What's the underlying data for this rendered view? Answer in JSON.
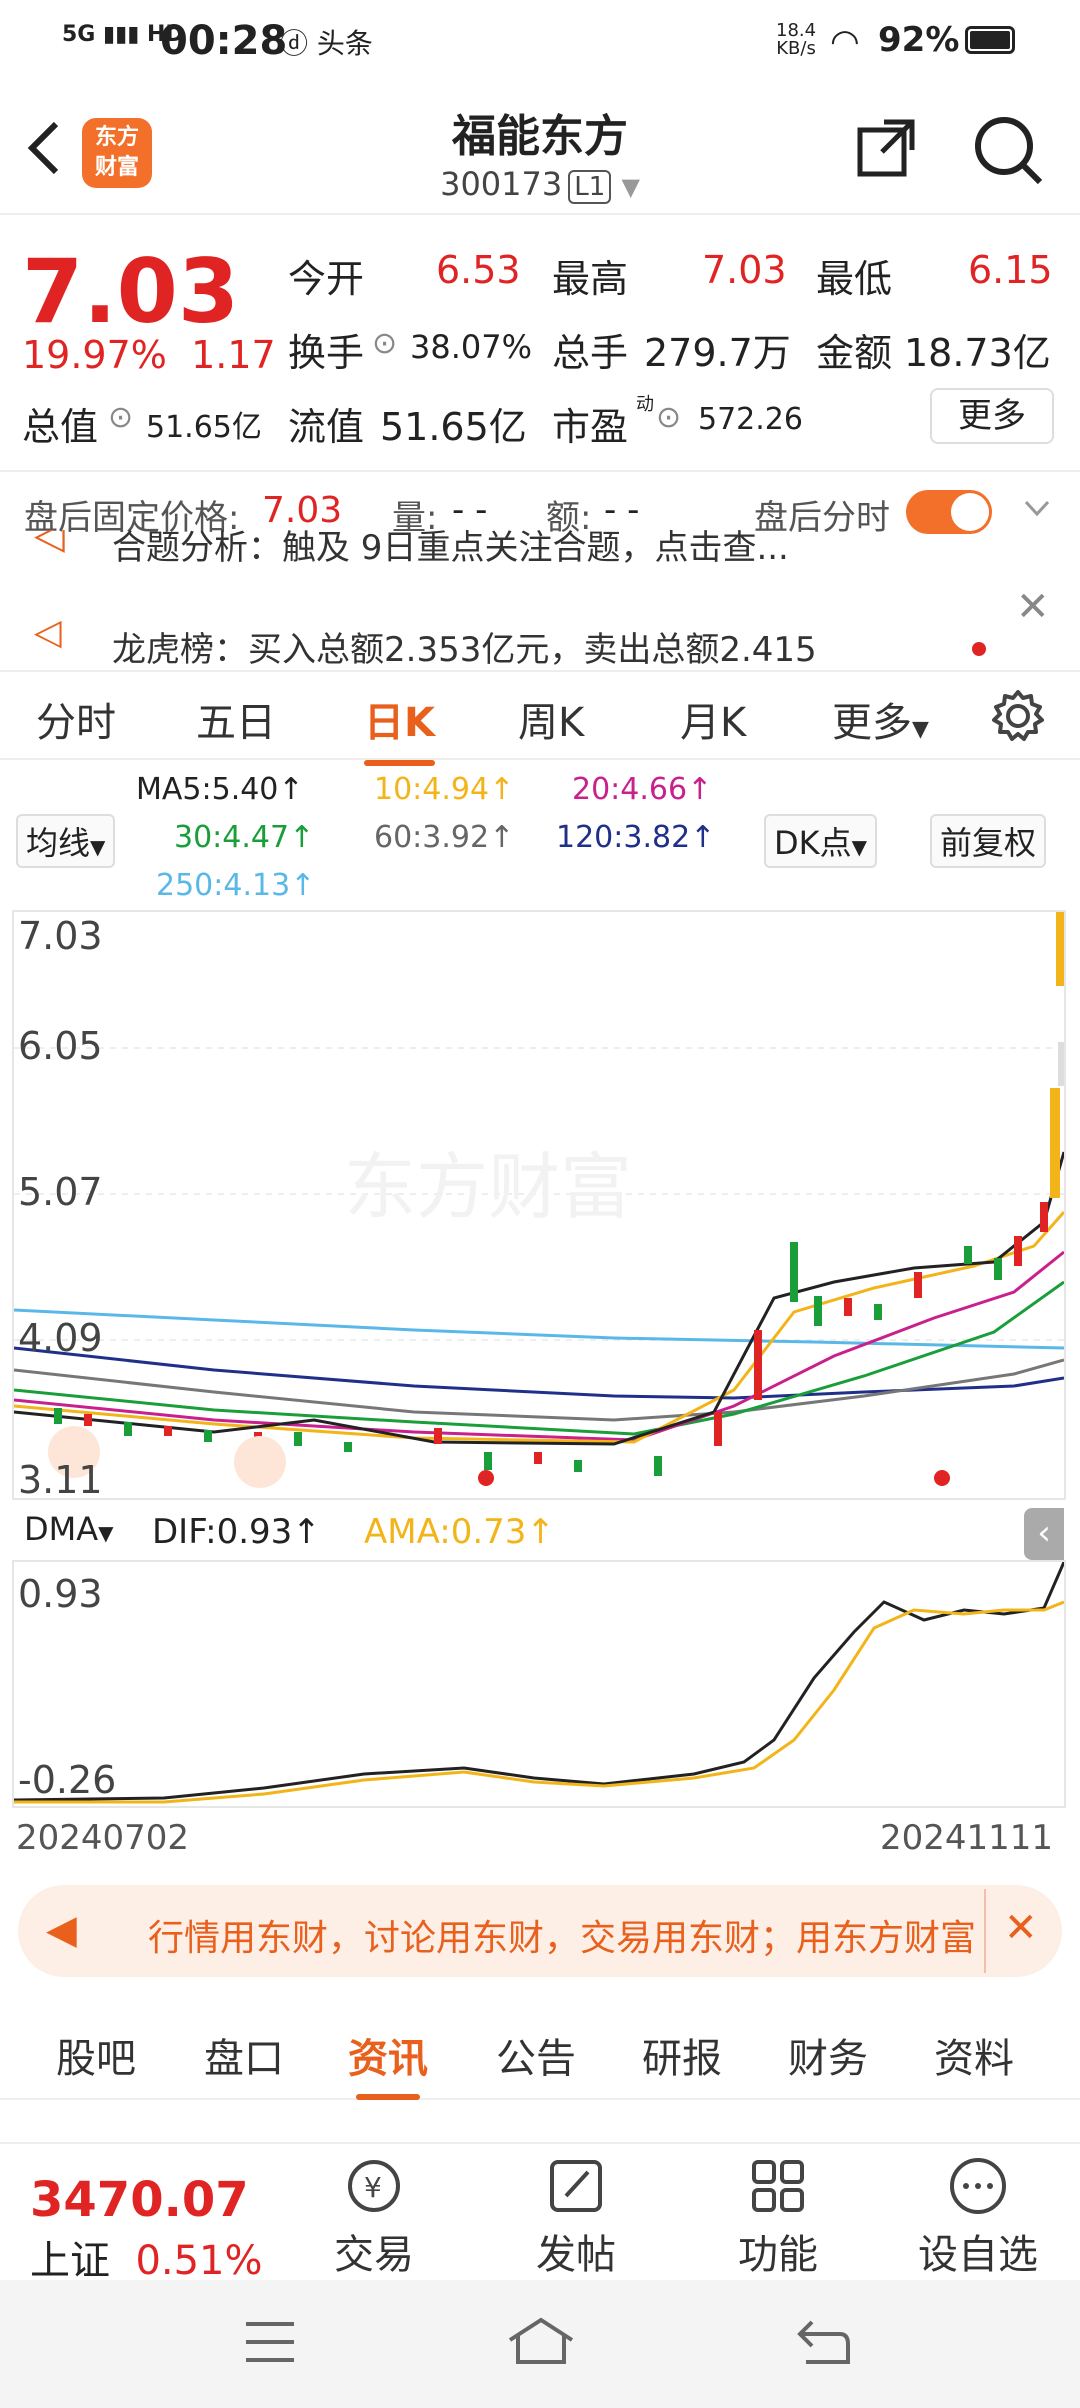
{
  "status": {
    "signal": "5G",
    "hd": "HD",
    "time": "00:28",
    "speed_value": "18.4",
    "speed_unit": "KB/s",
    "battery": "92%"
  },
  "header": {
    "logo_line1": "东方",
    "logo_line2": "财富",
    "title": "福能东方",
    "code": "300173",
    "level": "L1"
  },
  "quote": {
    "price": "7.03",
    "change_pct": "19.97%",
    "change_abs": "1.17",
    "open_label": "今开",
    "open": "6.53",
    "high_label": "最高",
    "high": "7.03",
    "low_label": "最低",
    "low": "6.15",
    "turnover_label": "换手",
    "turnover": "38.07%",
    "volume_label": "总手",
    "volume": "279.7万",
    "amount_label": "金额",
    "amount": "18.73亿",
    "mktcap_label": "总值",
    "mktcap": "51.65亿",
    "float_label": "流值",
    "float": "51.65亿",
    "pe_label": "市盈",
    "pe_sup": "动",
    "pe": "572.26",
    "more": "更多"
  },
  "after_hours": {
    "price_label": "盘后固定价格:",
    "price": "7.03",
    "vol_label": "量:",
    "vol": "- -",
    "amt_label": "额:",
    "amt": "- -",
    "toggle_label": "盘后分时"
  },
  "news": [
    {
      "text": "合题分析：触及 9日重点关注合题，点击查..."
    },
    {
      "text": "龙虎榜：买入总额2.353亿元，卖出总额2.415"
    }
  ],
  "ktabs": [
    {
      "label": "分时"
    },
    {
      "label": "五日"
    },
    {
      "label": "日K"
    },
    {
      "label": "周K"
    },
    {
      "label": "月K"
    },
    {
      "label": "更多"
    }
  ],
  "ma": {
    "selector": "均线",
    "ma5": "MA5:5.40↑",
    "ma10": "10:4.94↑",
    "ma20": "20:4.66↑",
    "ma30": "30:4.47↑",
    "ma60": "60:3.92↑",
    "ma120": "120:3.82↑",
    "ma250": "250:4.13↑",
    "dk": "DK点",
    "fq": "前复权",
    "colors": {
      "ma5": "#222222",
      "ma10": "#f2b418",
      "ma20": "#c8208c",
      "ma30": "#1a9e3a",
      "ma60": "#666666",
      "ma120": "#1f2f8a",
      "ma250": "#5ab8e8"
    }
  },
  "chart": {
    "y_labels": [
      "7.03",
      "6.05",
      "5.07",
      "4.09",
      "3.11"
    ],
    "watermark": "东方财富",
    "dma_selector": "DMA",
    "dif": "DIF:0.93↑",
    "ama": "AMA:0.73↑",
    "dma_y_labels": [
      "0.93",
      "-0.26"
    ],
    "date_start": "20240702",
    "date_end": "20241111"
  },
  "banner": {
    "text": "行情用东财，讨论用东财，交易用东财；用东方财富"
  },
  "info_tabs": [
    {
      "label": "股吧"
    },
    {
      "label": "盘口"
    },
    {
      "label": "资讯"
    },
    {
      "label": "公告"
    },
    {
      "label": "研报"
    },
    {
      "label": "财务"
    },
    {
      "label": "资料"
    }
  ],
  "bottom": {
    "index_value": "3470.07",
    "index_name": "上证",
    "index_chg": "0.51%",
    "trade": "交易",
    "post": "发帖",
    "func": "功能",
    "watch": "设自选"
  }
}
